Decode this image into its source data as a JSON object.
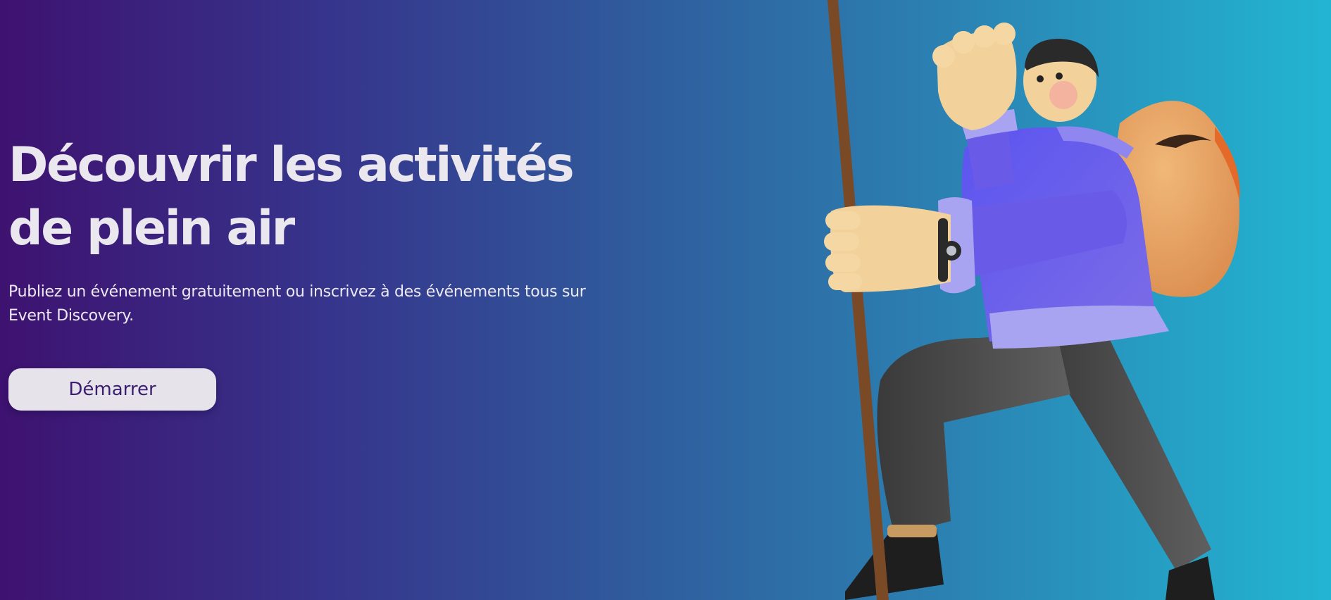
{
  "hero": {
    "headline": "Découvrir les activités de plein air",
    "subtitle": "Publiez un événement gratuitement ou inscrivez à des événements tous sur Event Discovery.",
    "cta_label": "Démarrer"
  },
  "illustration": {
    "subject": "hiker-with-backpack-and-walking-stick"
  },
  "colors": {
    "gradient_start": "#3e1270",
    "gradient_end": "#22b5d2",
    "headline_text": "#ebe7ef",
    "button_bg": "#e6e4ea",
    "button_text": "#3b1e70",
    "jacket": "#6a5ae8",
    "backpack": "#e9a462",
    "pants": "#4a4a4a",
    "stick": "#7a4a26",
    "skin": "#f2d29a"
  }
}
